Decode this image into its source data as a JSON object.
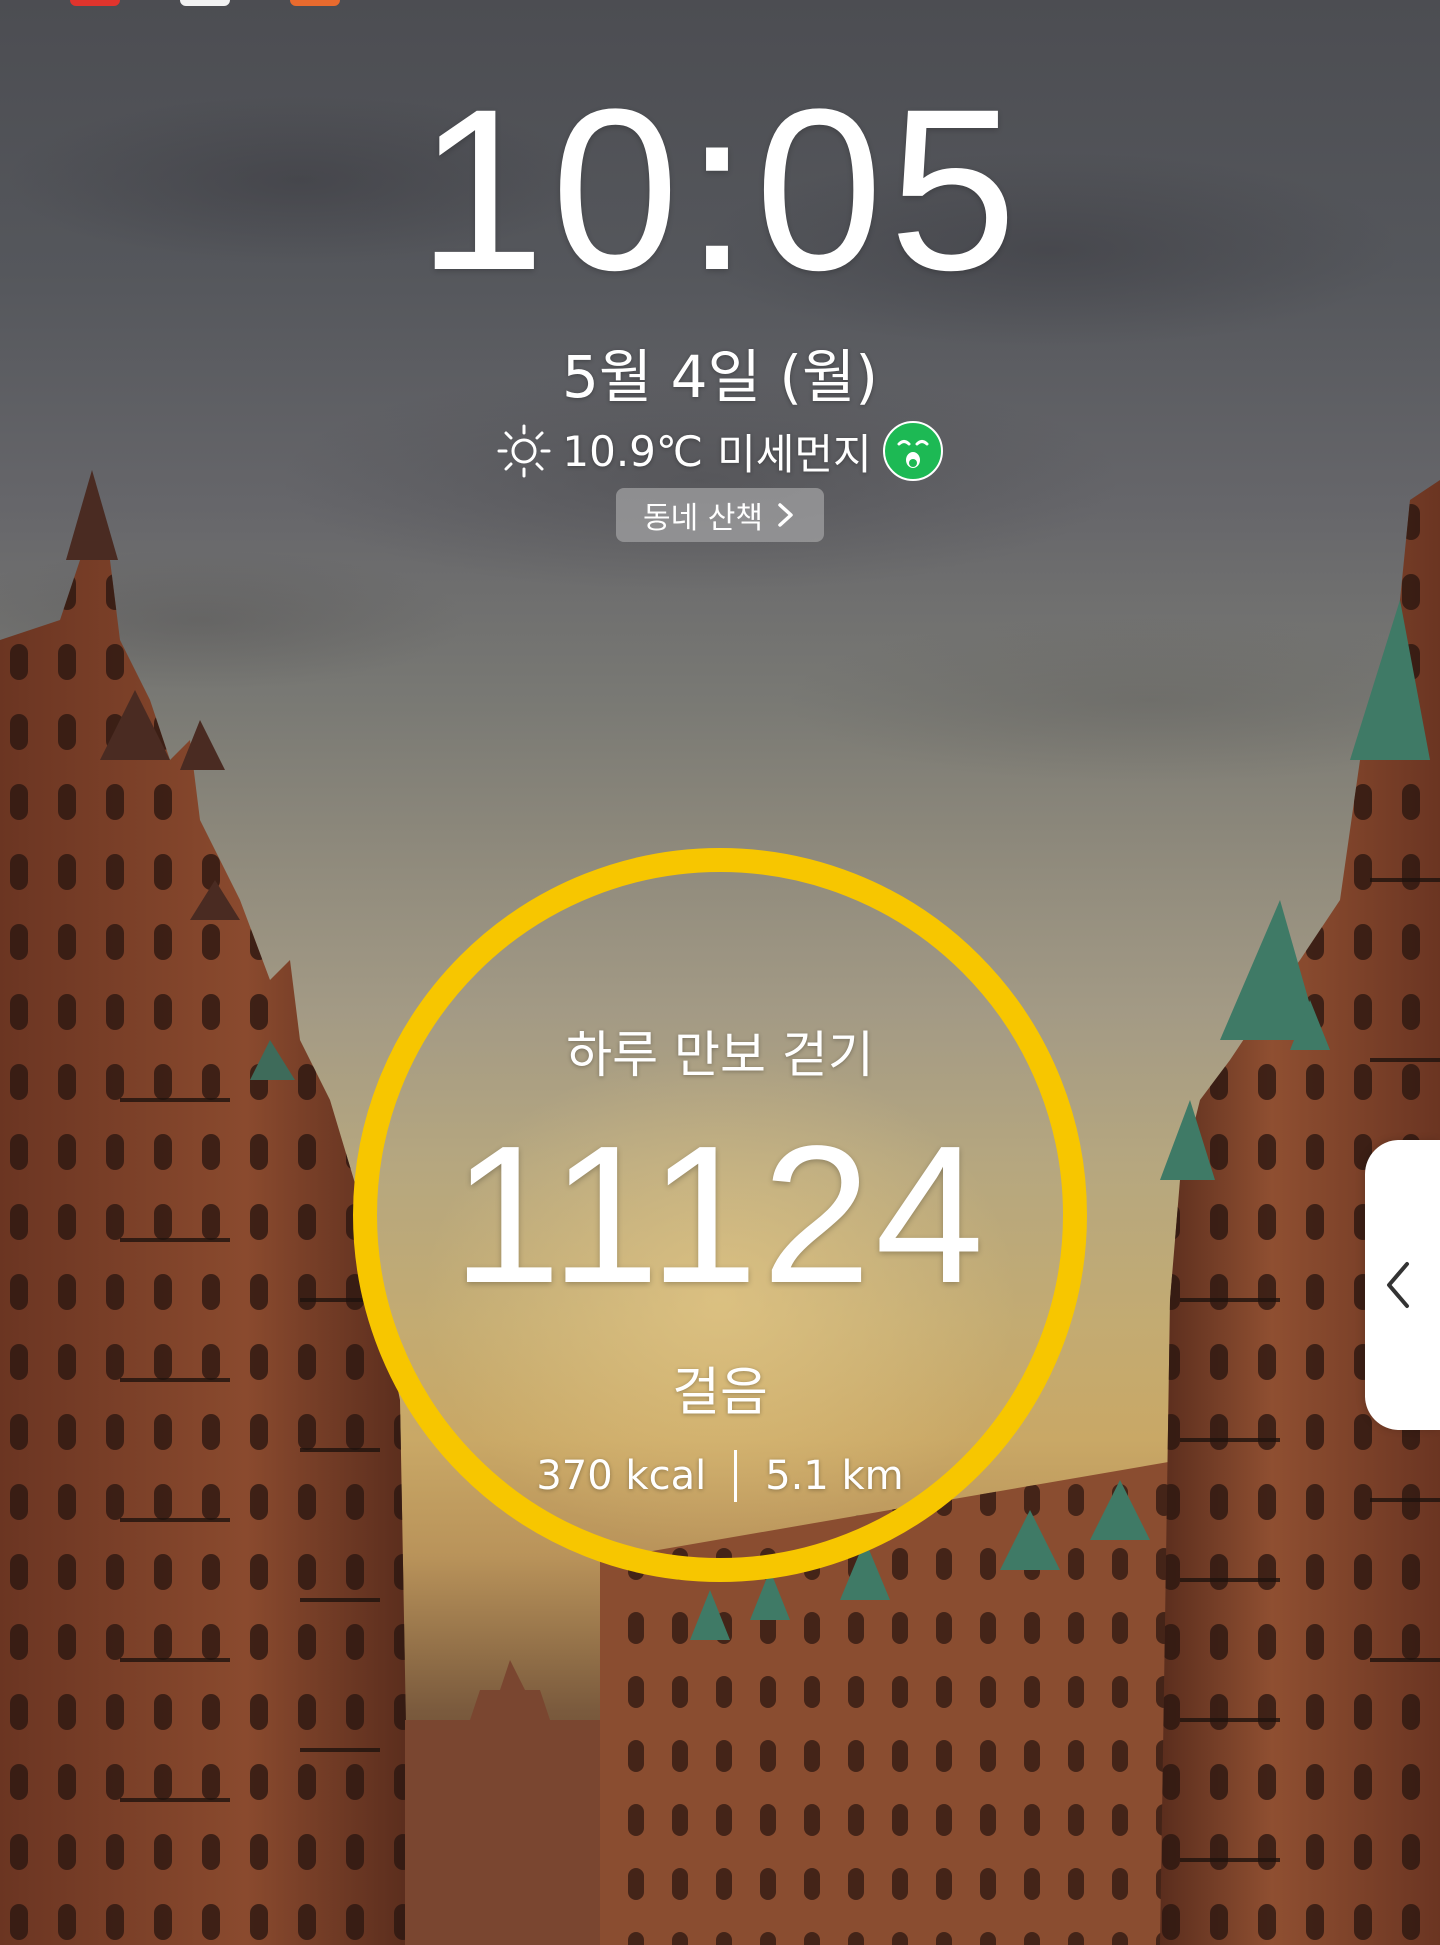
{
  "lockscreen": {
    "time": "10:05",
    "date": "5월 4일 (월)",
    "weather": {
      "icon": "sun-icon",
      "temperature": "10.9℃",
      "fine_dust_label": "미세먼지",
      "fine_dust_icon": "good-air-face-icon",
      "fine_dust_color": "#1db954"
    },
    "walk_button": {
      "label": "동네 산책",
      "icon": "chevron-right-icon"
    }
  },
  "pedometer": {
    "title": "하루 만보 걷기",
    "steps": "11124",
    "unit": "걸음",
    "calories": "370 kcal",
    "distance": "5.1 km",
    "ring_color": "#f7c600"
  },
  "edge_panel": {
    "icon": "chevron-left-icon"
  },
  "status_bar_colors": [
    "#e0342d",
    "#f2f2f2",
    "#e86a2e"
  ]
}
